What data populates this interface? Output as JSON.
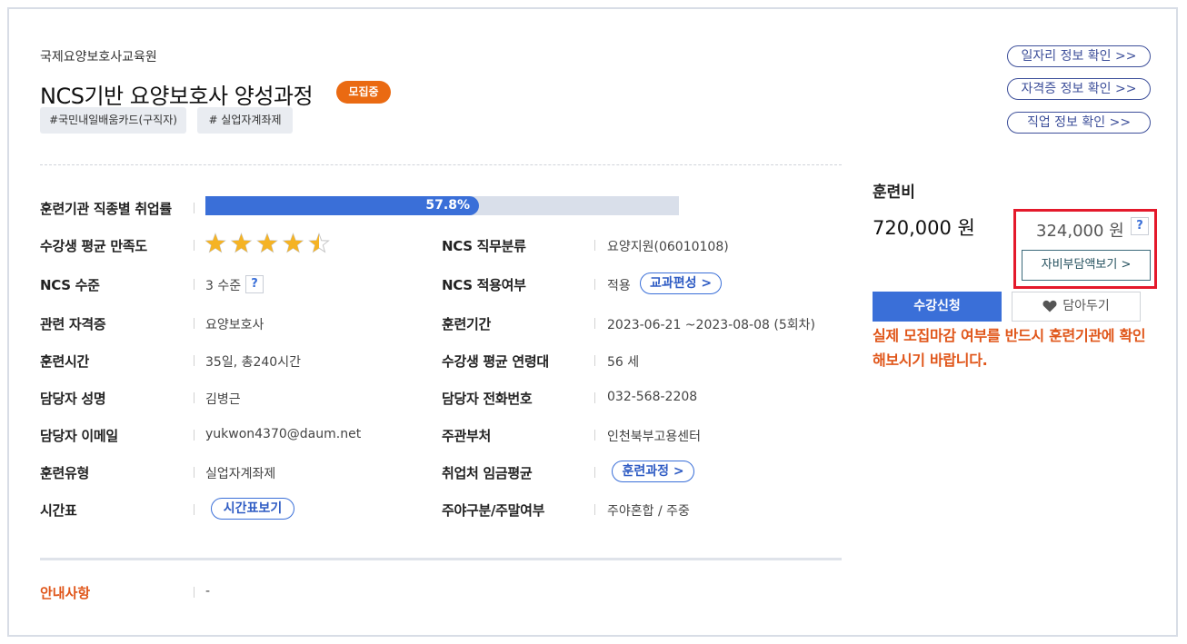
{
  "header": {
    "institute": "국제요양보호사교육원",
    "course_title": "NCS기반 요양보호사 양성과정",
    "badge": "모집중",
    "tags": [
      "#국민내일배움카드(구직자)",
      "# 실업자계좌제"
    ]
  },
  "links": {
    "job_info": "일자리 정보 확인 >>",
    "cert_info": "자격증 정보 확인 >>",
    "career_info": "직업 정보 확인 >>"
  },
  "details": {
    "employment_rate": {
      "label": "훈련기관 직종별 취업률",
      "value": "57.8%",
      "fraction": 0.578
    },
    "satisfaction": {
      "label": "수강생 평균 만족도",
      "rating": 4.5,
      "max": 5
    },
    "ncs_classification": {
      "label": "NCS 직무분류",
      "value": "요양지원(06010108)"
    },
    "ncs_level": {
      "label": "NCS 수준",
      "value": "3 수준",
      "help": "?"
    },
    "ncs_applied": {
      "label": "NCS 적용여부",
      "value": "적용",
      "button": "교과편성 >"
    },
    "related_cert": {
      "label": "관련 자격증",
      "value": "요양보호사"
    },
    "training_period": {
      "label": "훈련기간",
      "value": "2023-06-21 ~2023-08-08 (5회차)"
    },
    "training_hours": {
      "label": "훈련시간",
      "value": "35일, 총240시간"
    },
    "avg_age": {
      "label": "수강생 평균 연령대",
      "value": "56 세"
    },
    "manager_name": {
      "label": "담당자 성명",
      "value": "김병근"
    },
    "manager_phone": {
      "label": "담당자 전화번호",
      "value": "032-568-2208"
    },
    "manager_email": {
      "label": "담당자 이메일",
      "value": "yukwon4370@daum.net"
    },
    "supervisor": {
      "label": "주관부처",
      "value": "인천북부고용센터"
    },
    "training_type": {
      "label": "훈련유형",
      "value": "실업자계좌제"
    },
    "avg_wage": {
      "label": "취업처 임금평균",
      "button": "훈련과정 >"
    },
    "timetable": {
      "label": "시간표",
      "button": "시간표보기"
    },
    "day_night": {
      "label": "주야구분/주말여부",
      "value": "주야혼합 / 주중"
    },
    "notice": {
      "label": "안내사항",
      "value": "-"
    }
  },
  "fee": {
    "label": "훈련비",
    "amount": "720,000 원",
    "self_pay_amount": "324,000 원",
    "help": "?",
    "self_pay_button": "자비부담액보기 >"
  },
  "actions": {
    "apply": "수강신청",
    "wishlist": "담아두기",
    "notice": "실제 모집마감 여부를 반드시 훈련기관에 확인해보시기 바랍니다."
  },
  "colors": {
    "accent_blue": "#3a6fd8",
    "badge_orange": "#ea6a12",
    "notice_orange": "#e0561a",
    "highlight_red": "#e4192b",
    "star_gold": "#f5b324"
  }
}
